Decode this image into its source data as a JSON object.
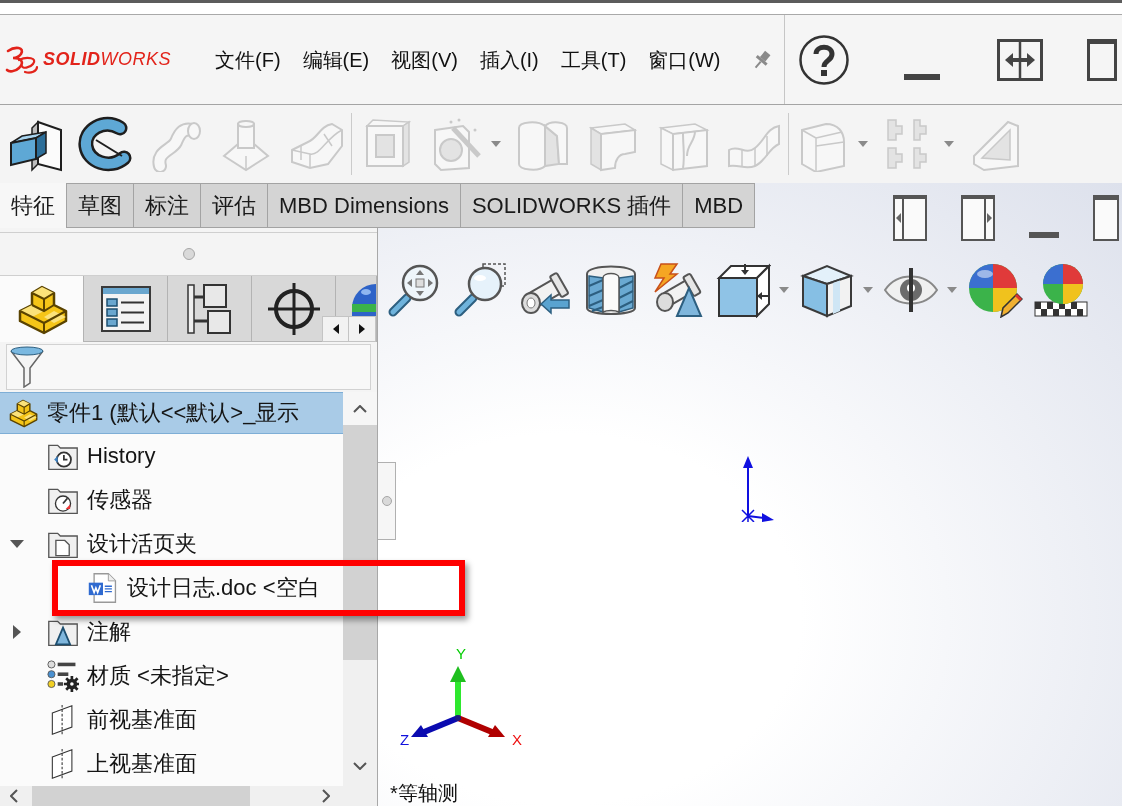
{
  "logo": "**SOLID**WORKS",
  "menu": [
    "文件(F)",
    "编辑(E)",
    "视图(V)",
    "插入(I)",
    "工具(T)",
    "窗口(W)"
  ],
  "feature_toolbar": [
    [
      {
        "kind": "extrude",
        "disabled": false,
        "dropdown": false
      },
      {
        "kind": "revolve",
        "disabled": false,
        "dropdown": false
      },
      {
        "kind": "sweep",
        "disabled": true,
        "dropdown": false
      },
      {
        "kind": "loft",
        "disabled": true,
        "dropdown": false
      },
      {
        "kind": "boundary",
        "disabled": true,
        "dropdown": false
      }
    ],
    [
      {
        "kind": "extrudecut",
        "disabled": true,
        "dropdown": false
      },
      {
        "kind": "holewizard",
        "disabled": true,
        "dropdown": true
      },
      {
        "kind": "revolvecut",
        "disabled": true,
        "dropdown": false
      },
      {
        "kind": "sweepcut",
        "disabled": true,
        "dropdown": false
      },
      {
        "kind": "loftcut",
        "disabled": true,
        "dropdown": false
      },
      {
        "kind": "boundarycut",
        "disabled": true,
        "dropdown": false
      }
    ],
    [
      {
        "kind": "fillet",
        "disabled": true,
        "dropdown": true
      },
      {
        "kind": "pattern",
        "disabled": true,
        "dropdown": true
      },
      {
        "kind": "rib",
        "disabled": true,
        "dropdown": false
      }
    ]
  ],
  "command_tabs": [
    {
      "label": "特征",
      "selected": true
    },
    {
      "label": "草图",
      "selected": false
    },
    {
      "label": "标注",
      "selected": false
    },
    {
      "label": "评估",
      "selected": false
    },
    {
      "label": "MBD Dimensions",
      "selected": false
    },
    {
      "label": "SOLIDWORKS 插件",
      "selected": false
    },
    {
      "label": "MBD",
      "selected": false
    }
  ],
  "panel_tabs": [
    {
      "kind": "feature",
      "selected": true
    },
    {
      "kind": "property",
      "selected": false
    },
    {
      "kind": "configuration",
      "selected": false
    },
    {
      "kind": "dimxpert",
      "selected": false
    },
    {
      "kind": "display",
      "selected": false
    }
  ],
  "tree": {
    "kind": "part",
    "label": "零件1 (默认<<默认>_显示",
    "selected": true,
    "highlighted": false,
    "children": [
      {
        "kind": "history",
        "label": "History",
        "selected": false,
        "highlighted": false
      },
      {
        "kind": "sensors",
        "label": "传感器",
        "selected": false,
        "highlighted": false
      },
      {
        "kind": "binder",
        "label": "设计活页夹",
        "selected": false,
        "highlighted": false,
        "expanded": true,
        "children": [
          {
            "kind": "document",
            "label": "设计日志.doc <空白",
            "selected": false,
            "highlighted": true
          }
        ]
      },
      {
        "kind": "annotations",
        "label": "注解",
        "selected": false,
        "highlighted": false,
        "expanded": false
      },
      {
        "kind": "material",
        "label": "材质 <未指定>",
        "selected": false,
        "highlighted": false
      },
      {
        "kind": "plane",
        "label": "前视基准面",
        "selected": false,
        "highlighted": false
      },
      {
        "kind": "plane",
        "label": "上视基准面",
        "selected": false,
        "highlighted": false
      }
    ]
  },
  "view_toolbar": [
    {
      "kind": "zoomfit",
      "dropdown": false
    },
    {
      "kind": "zoomarea",
      "dropdown": false
    },
    {
      "kind": "previous",
      "dropdown": false
    },
    {
      "kind": "section",
      "dropdown": false
    },
    {
      "kind": "annotation",
      "dropdown": false
    },
    {
      "kind": "orientation",
      "dropdown": true
    },
    {
      "kind": "style",
      "dropdown": true
    },
    {
      "kind": "hideshow",
      "dropdown": true
    },
    {
      "kind": "appearance",
      "dropdown": false
    },
    {
      "kind": "scene",
      "dropdown": false
    }
  ],
  "viewport": {
    "view_name": "*等轴测",
    "triad": {
      "x": "X",
      "y": "Y",
      "z": "Z"
    }
  }
}
